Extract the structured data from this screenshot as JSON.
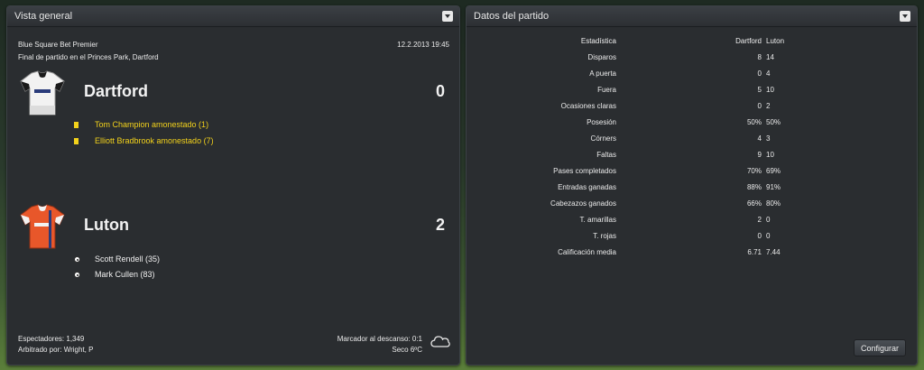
{
  "overview": {
    "title": "Vista general",
    "competition": "Blue Square Bet Premier",
    "datetime": "12.2.2013 19:45",
    "venue": "Final de partido en el Princes Park, Dartford",
    "home": {
      "name": "Dartford",
      "score": "0",
      "kit_colors": {
        "primary": "#f2f2f2",
        "trim": "#1a1a1a"
      },
      "events": [
        {
          "type": "yellow-card",
          "text": "Tom Champion amonestado (1)"
        },
        {
          "type": "yellow-card",
          "text": "Elliott Bradbrook amonestado (7)"
        }
      ]
    },
    "away": {
      "name": "Luton",
      "score": "2",
      "kit_colors": {
        "primary": "#e8572a",
        "trim": "#f2f2f2"
      },
      "events": [
        {
          "type": "goal",
          "text": "Scott Rendell (35)"
        },
        {
          "type": "goal",
          "text": "Mark Cullen (83)"
        }
      ]
    },
    "footer": {
      "attendance": "Espectadores: 1,349",
      "referee": "Arbitrado por: Wright, P",
      "halftime": "Marcador al descanso: 0:1",
      "weather": "Seco 6ºC",
      "weather_icon": "cloud-icon"
    }
  },
  "match_stats": {
    "title": "Datos del partido",
    "header": {
      "label": "Estadística",
      "home": "Dartford",
      "away": "Luton"
    },
    "rows": [
      {
        "label": "Disparos",
        "home": "8",
        "away": "14"
      },
      {
        "label": "A puerta",
        "home": "0",
        "away": "4"
      },
      {
        "label": "Fuera",
        "home": "5",
        "away": "10"
      },
      {
        "label": "Ocasiones claras",
        "home": "0",
        "away": "2"
      },
      {
        "label": "Posesión",
        "home": "50%",
        "away": "50%"
      },
      {
        "label": "Córners",
        "home": "4",
        "away": "3"
      },
      {
        "label": "Faltas",
        "home": "9",
        "away": "10"
      },
      {
        "label": "Pases completados",
        "home": "70%",
        "away": "69%"
      },
      {
        "label": "Entradas ganadas",
        "home": "88%",
        "away": "91%"
      },
      {
        "label": "Cabezazos ganados",
        "home": "66%",
        "away": "80%"
      },
      {
        "label": "T. amarillas",
        "home": "2",
        "away": "0"
      },
      {
        "label": "T. rojas",
        "home": "0",
        "away": "0"
      },
      {
        "label": "Calificación media",
        "home": "6.71",
        "away": "7.44"
      }
    ],
    "configure_label": "Configurar"
  }
}
